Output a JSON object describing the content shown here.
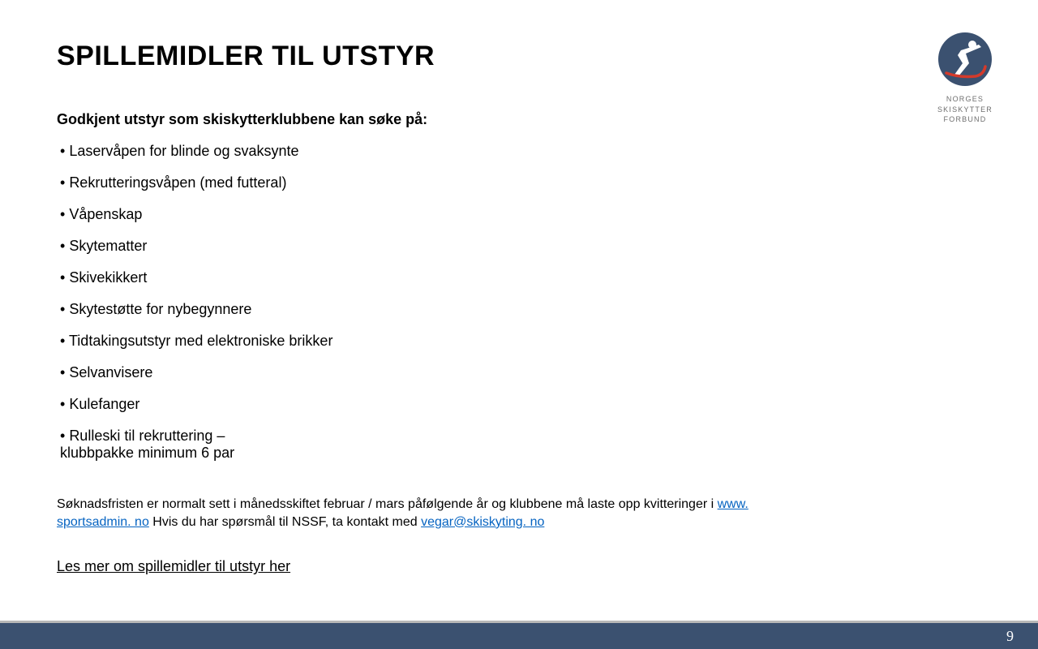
{
  "title": "SPILLEMIDLER TIL UTSTYR",
  "intro": "Godkjent utstyr som skiskytterklubbene kan søke på:",
  "items": [
    "Laservåpen for blinde og svaksynte",
    "Rekrutteringsvåpen (med futteral)",
    "Våpenskap",
    "Skytematter",
    "Skivekikkert",
    "Skytestøtte for nybegynnere",
    "Tidtakingsutstyr med elektroniske brikker",
    "Selvanvisere",
    "Kulefanger",
    "Rulleski til rekruttering – klubbpakke minimum 6 par"
  ],
  "note": {
    "part1": "Søknadsfristen er normalt sett i månedsskiftet februar / mars påfølgende år og klubbene må laste opp kvitteringer i ",
    "link1": "www. sportsadmin. no",
    "part2": " Hvis du har spørsmål til NSSF, ta kontakt med ",
    "link2": "vegar@skiskyting. no"
  },
  "read_more": "Les mer om spillemidler til utstyr her",
  "logo": {
    "line1": "NORGES",
    "line2": "SKISKYTTER",
    "line3": "FORBUND"
  },
  "page_number": "9"
}
